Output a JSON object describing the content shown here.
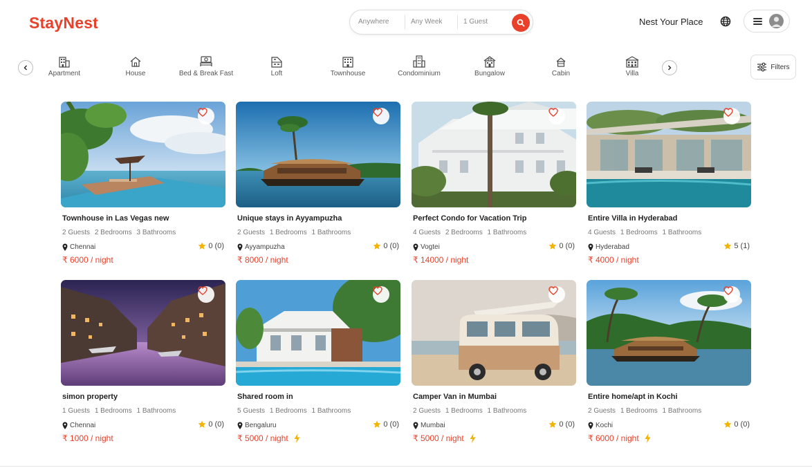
{
  "header": {
    "logo": "StayNest",
    "search": {
      "where": "Anywhere",
      "when": "Any Week",
      "guests": "1 Guest"
    },
    "host_link": "Nest Your Place"
  },
  "categories": [
    {
      "label": "Apartment",
      "icon": "apartment-icon"
    },
    {
      "label": "House",
      "icon": "house-icon"
    },
    {
      "label": "Bed & Break Fast",
      "icon": "bed-breakfast-icon"
    },
    {
      "label": "Loft",
      "icon": "loft-icon"
    },
    {
      "label": "Townhouse",
      "icon": "townhouse-icon"
    },
    {
      "label": "Condominium",
      "icon": "condominium-icon"
    },
    {
      "label": "Bungalow",
      "icon": "bungalow-icon"
    },
    {
      "label": "Cabin",
      "icon": "cabin-icon"
    },
    {
      "label": "Villa",
      "icon": "villa-icon"
    }
  ],
  "filters_label": "Filters",
  "colors": {
    "accent": "#e8402a",
    "star": "#f5b301",
    "bolt": "#f5b301"
  },
  "listings": [
    {
      "title": "Townhouse in Las Vegas new",
      "guests": "2 Guests",
      "bedrooms": "2 Bedrooms",
      "bathrooms": "3 Bathrooms",
      "location": "Chennai",
      "rating": "0 (0)",
      "price": "₹ 6000 / night",
      "instant": false
    },
    {
      "title": "Unique stays in Ayyampuzha",
      "guests": "2 Guests",
      "bedrooms": "1 Bedrooms",
      "bathrooms": "1 Bathrooms",
      "location": "Ayyampuzha",
      "rating": "0 (0)",
      "price": "₹ 8000 / night",
      "instant": false
    },
    {
      "title": "Perfect Condo for Vacation Trip",
      "guests": "4 Guests",
      "bedrooms": "2 Bedrooms",
      "bathrooms": "1 Bathrooms",
      "location": "Vogtei",
      "rating": "0 (0)",
      "price": "₹ 14000 / night",
      "instant": false
    },
    {
      "title": "Entire Villa in Hyderabad",
      "guests": "4 Guests",
      "bedrooms": "1 Bedrooms",
      "bathrooms": "1 Bathrooms",
      "location": "Hyderabad",
      "rating": "5 (1)",
      "price": "₹ 4000 / night",
      "instant": false
    },
    {
      "title": "simon property",
      "guests": "1 Guests",
      "bedrooms": "1 Bedrooms",
      "bathrooms": "1 Bathrooms",
      "location": "Chennai",
      "rating": "0 (0)",
      "price": "₹ 1000 / night",
      "instant": false
    },
    {
      "title": "Shared room in",
      "guests": "5 Guests",
      "bedrooms": "1 Bedrooms",
      "bathrooms": "1 Bathrooms",
      "location": "Bengaluru",
      "rating": "0 (0)",
      "price": "₹ 5000 / night",
      "instant": true
    },
    {
      "title": "Camper Van in Mumbai",
      "guests": "2 Guests",
      "bedrooms": "1 Bedrooms",
      "bathrooms": "1 Bathrooms",
      "location": "Mumbai",
      "rating": "0 (0)",
      "price": "₹ 5000 / night",
      "instant": true
    },
    {
      "title": "Entire home/apt in Kochi",
      "guests": "2 Guests",
      "bedrooms": "1 Bedrooms",
      "bathrooms": "1 Bathrooms",
      "location": "Kochi",
      "rating": "0 (0)",
      "price": "₹ 6000 / night",
      "instant": true
    }
  ]
}
